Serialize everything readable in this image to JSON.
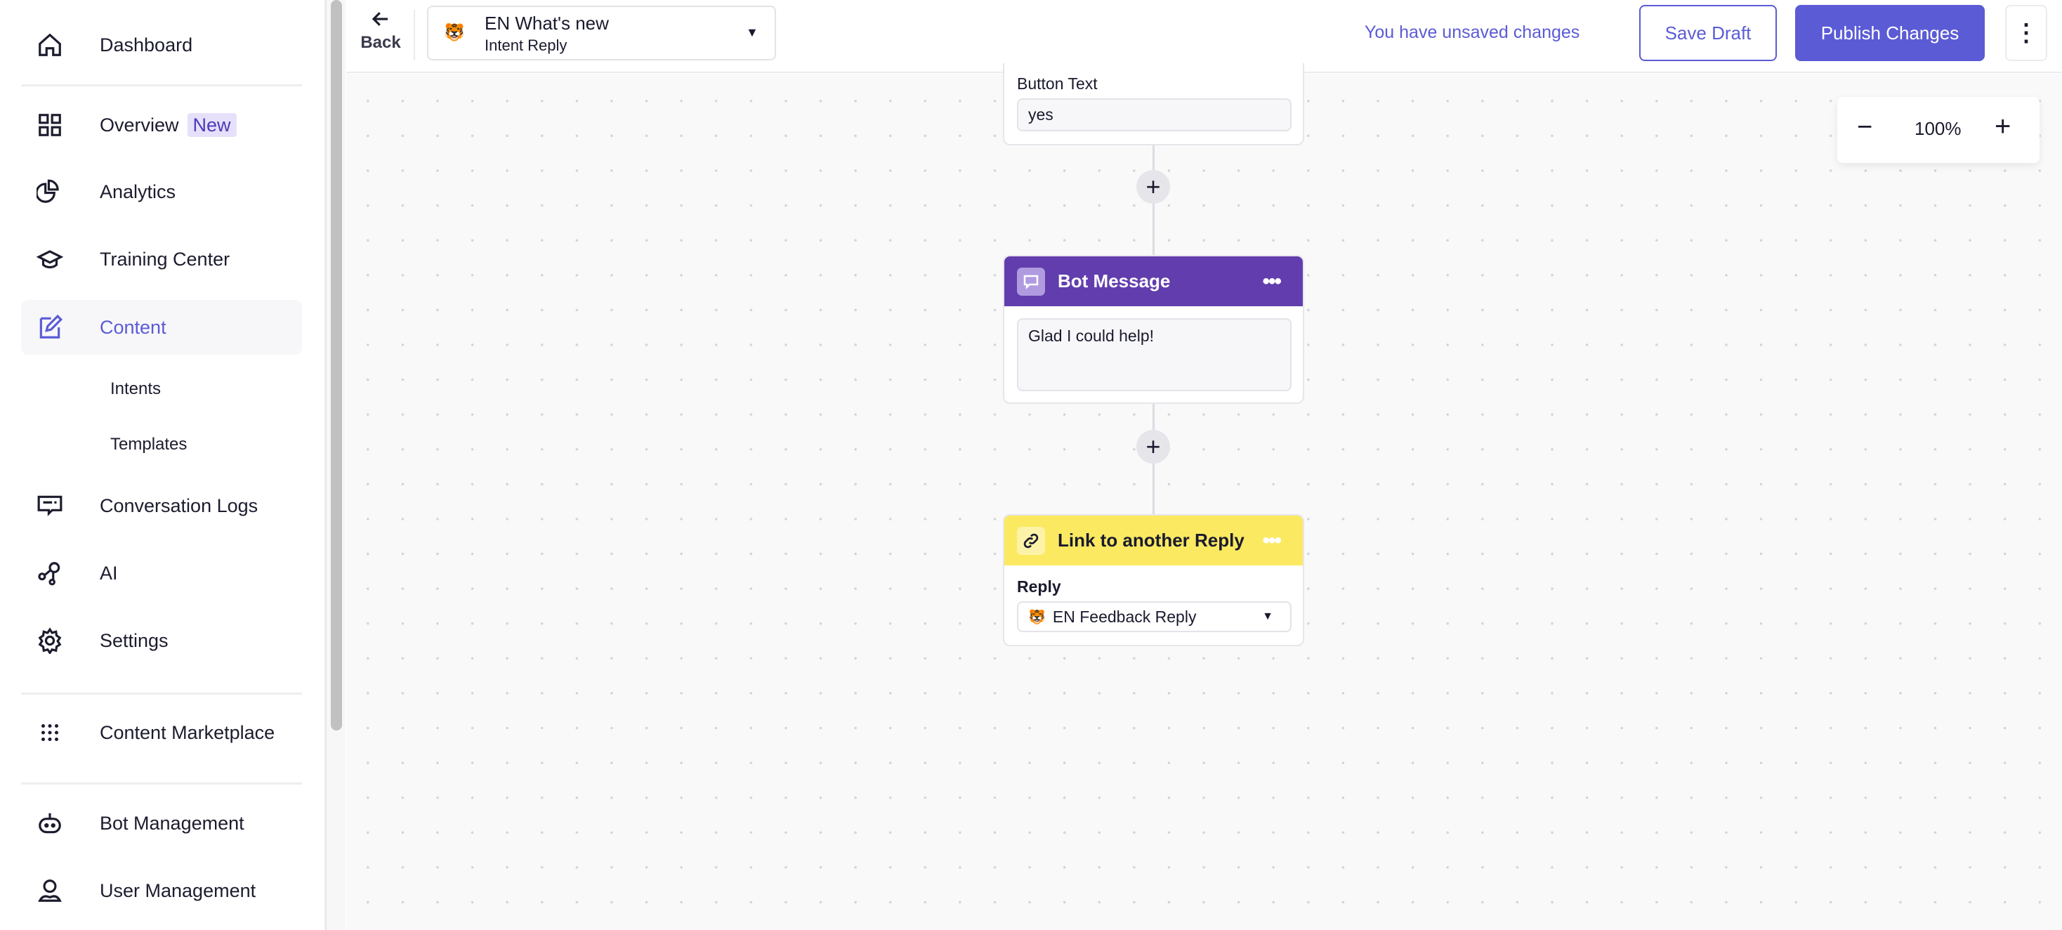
{
  "sidebar": {
    "items": [
      {
        "label": "Dashboard",
        "icon": "home-icon"
      },
      {
        "label": "Overview",
        "badge": "New",
        "icon": "grid-icon"
      },
      {
        "label": "Analytics",
        "icon": "pie-chart-icon"
      },
      {
        "label": "Training Center",
        "icon": "graduation-cap-icon"
      },
      {
        "label": "Content",
        "icon": "edit-icon",
        "active": true
      },
      {
        "label": "Conversation Logs",
        "icon": "chat-log-icon"
      },
      {
        "label": "AI",
        "icon": "nodes-icon"
      },
      {
        "label": "Settings",
        "icon": "gear-icon"
      },
      {
        "label": "Content Marketplace",
        "icon": "dots-grid-icon"
      },
      {
        "label": "Bot Management",
        "icon": "robot-icon"
      },
      {
        "label": "User Management",
        "icon": "user-icon"
      }
    ],
    "subitems": [
      {
        "label": "Intents"
      },
      {
        "label": "Templates"
      }
    ]
  },
  "header": {
    "back_label": "Back",
    "reply_selector": {
      "emoji": "🐯",
      "title": "EN What's new",
      "subtitle": "Intent Reply"
    },
    "unsaved_text": "You have unsaved changes",
    "save_draft": "Save Draft",
    "publish": "Publish Changes"
  },
  "zoom": {
    "value": "100%",
    "minus": "−",
    "plus": "+"
  },
  "flow": {
    "button_card": {
      "label": "Button Text",
      "value": "yes"
    },
    "bot_message": {
      "title": "Bot Message",
      "text": "Glad I could help!",
      "color": "#623DAE"
    },
    "link_card": {
      "title": "Link to another Reply",
      "reply_label": "Reply",
      "reply_emoji": "🐯",
      "reply_value": "EN Feedback Reply",
      "color": "#FBEA61"
    }
  },
  "colors": {
    "accent": "#5B5BD6"
  }
}
